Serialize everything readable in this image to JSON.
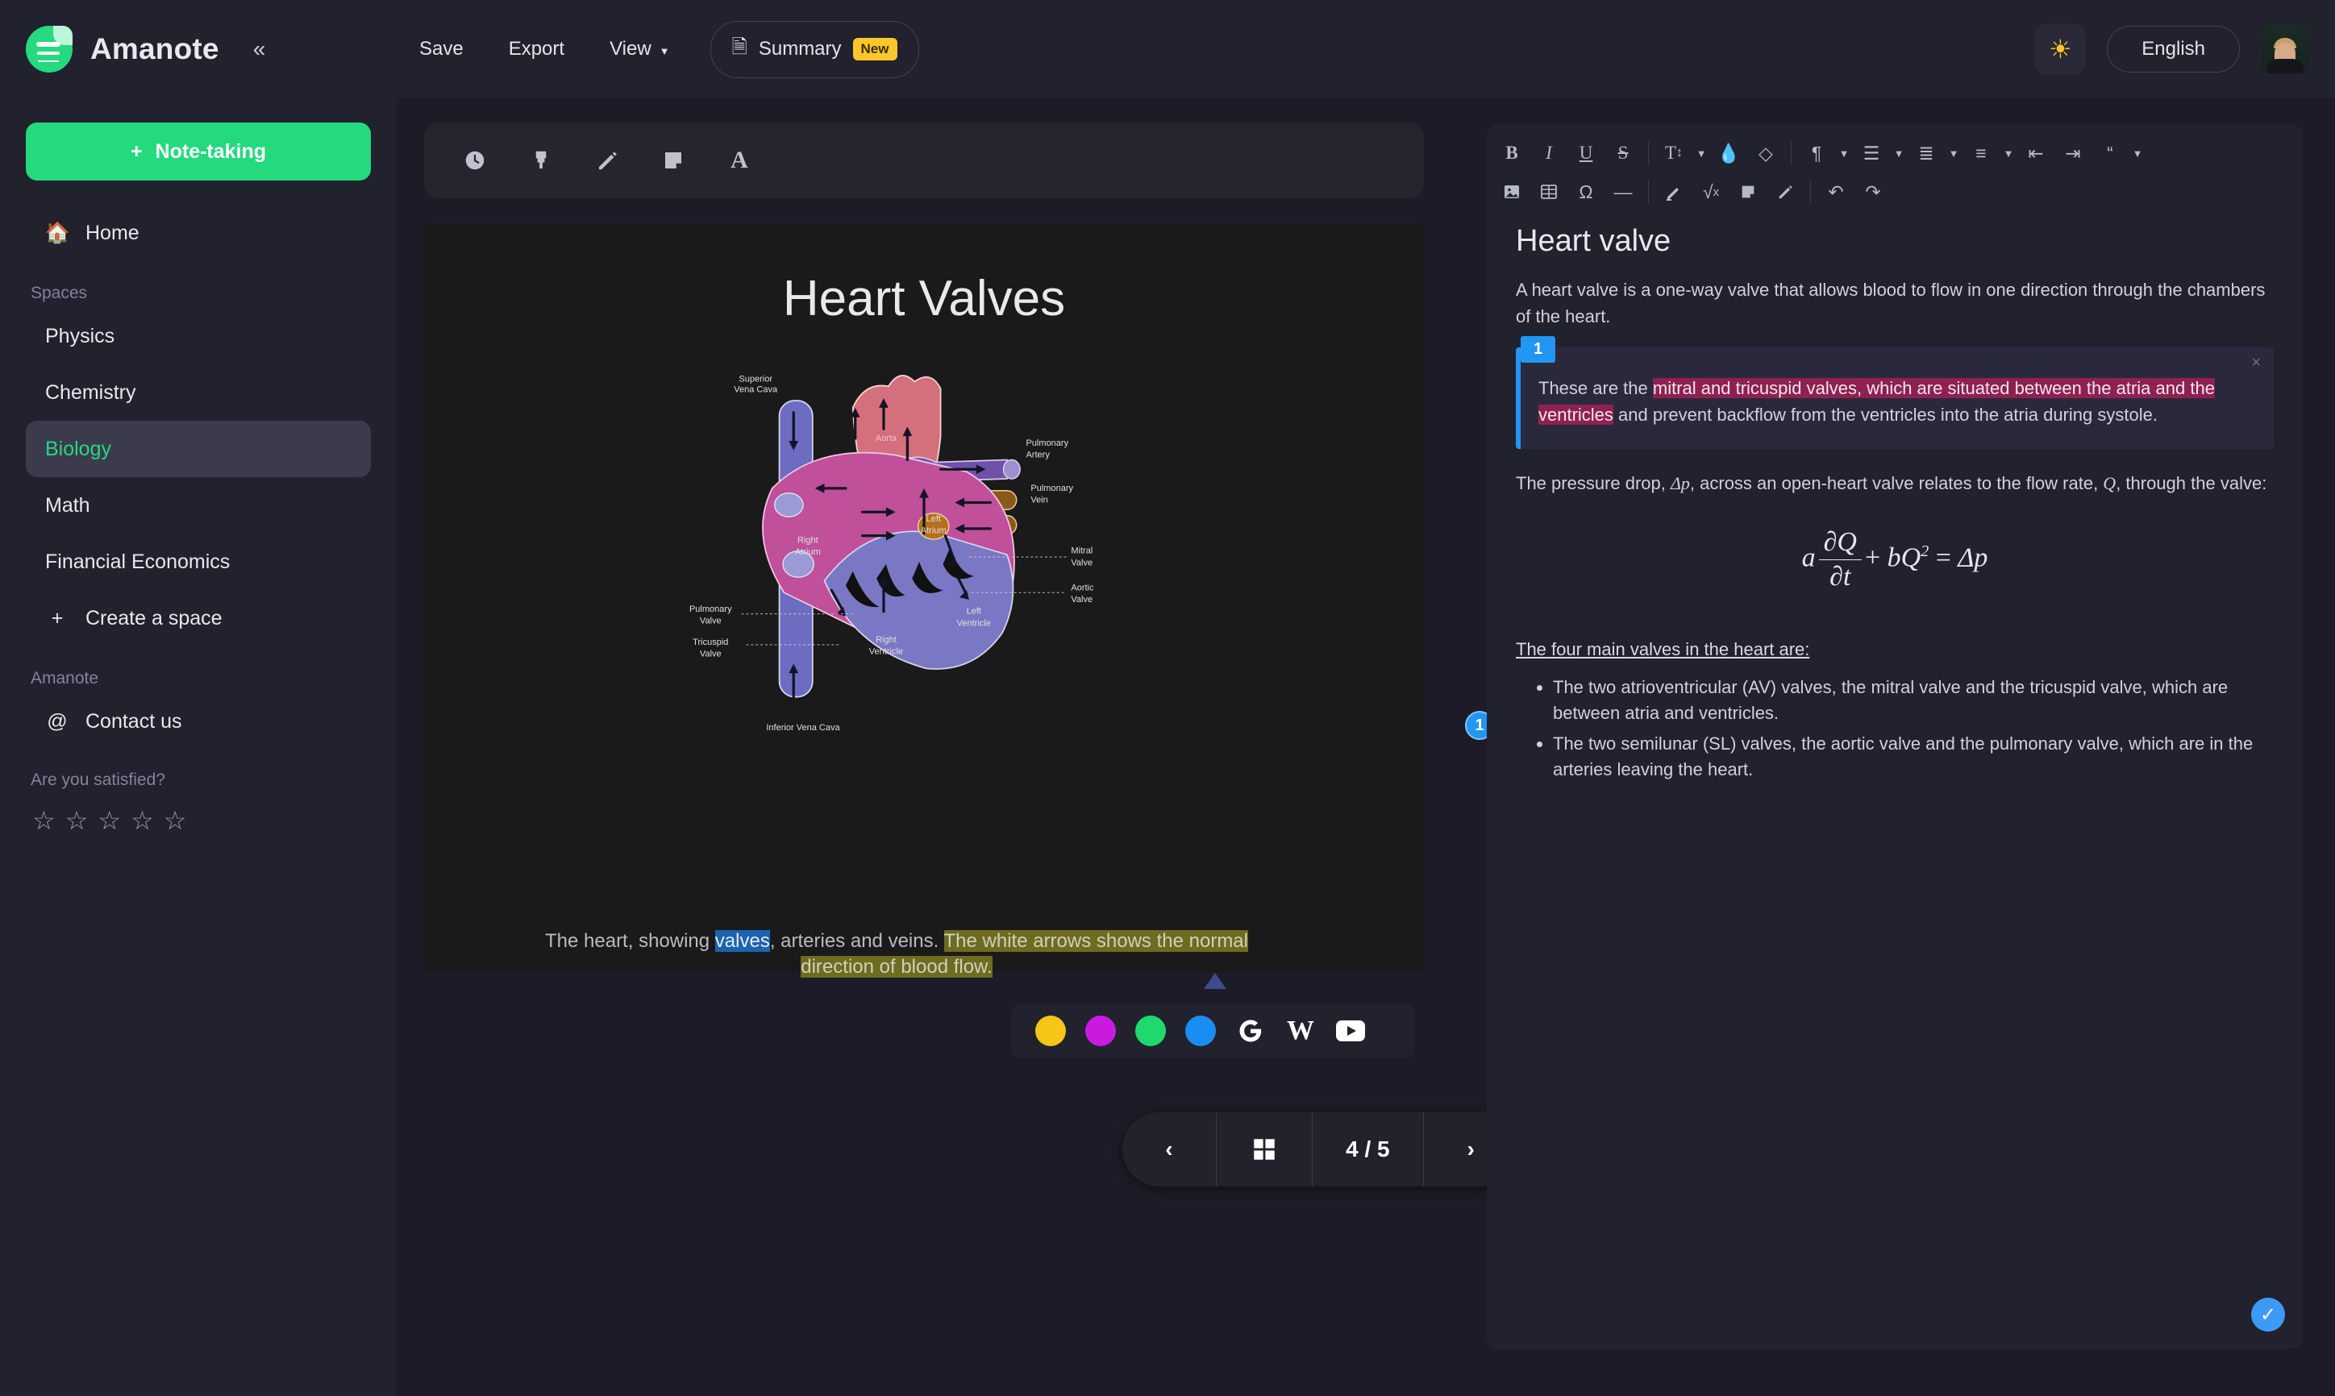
{
  "app": {
    "brand": "Amanote",
    "logo_color": "#24d97e",
    "collapse_icon": "chevron-double-left-icon"
  },
  "topbar": {
    "menu": [
      {
        "label": "Save",
        "name": "save"
      },
      {
        "label": "Export",
        "name": "export"
      },
      {
        "label": "View",
        "name": "view",
        "has_caret": true
      }
    ],
    "summary": {
      "label": "Summary",
      "badge": "New",
      "badge_color": "#fcc72c",
      "icon": "document-icon"
    },
    "theme_icon": "sun-icon",
    "language": "English",
    "avatar_name": "user-avatar"
  },
  "sidebar": {
    "note_taking_label": "Note-taking",
    "home_label": "Home",
    "spaces_heading": "Spaces",
    "spaces": [
      {
        "label": "Physics",
        "active": false
      },
      {
        "label": "Chemistry",
        "active": false
      },
      {
        "label": "Biology",
        "active": true
      },
      {
        "label": "Math",
        "active": false
      },
      {
        "label": "Financial Economics",
        "active": false
      }
    ],
    "create_space_label": "Create a space",
    "amanote_heading": "Amanote",
    "contact_label": "Contact us",
    "satisfaction_label": "Are you satisfied?",
    "stars": [
      "☆",
      "☆",
      "☆",
      "☆",
      "☆"
    ],
    "active_color": "#24d97e"
  },
  "viewer": {
    "tools": [
      {
        "name": "history-clock-icon"
      },
      {
        "name": "highlighter-brush-icon"
      },
      {
        "name": "pencil-icon"
      },
      {
        "name": "sticky-note-icon"
      },
      {
        "name": "text-tool-icon"
      }
    ],
    "slide_title": "Heart Valves",
    "diagram": {
      "alt": "heart-anatomy-diagram",
      "labels": [
        "Superior Vena Cava",
        "Aorta",
        "Pulmonary Artery",
        "Pulmonary Vein",
        "Right Atrium",
        "Left Atrium",
        "Mitral Valve",
        "Aortic Valve",
        "Pulmonary Valve",
        "Tricuspid Valve",
        "Right Ventricle",
        "Left Ventricle",
        "Inferior Vena Cava"
      ]
    },
    "annotation_badge": "1",
    "caption": {
      "part1": "The heart, showing ",
      "highlight_blue": "valves",
      "part2": ", arteries and veins. ",
      "highlight_olive": "The white arrows shows the normal direction of blood flow."
    },
    "color_popup": {
      "swatches": [
        {
          "name": "yellow-swatch",
          "color": "#f5c518"
        },
        {
          "name": "magenta-swatch",
          "color": "#cb1ae0"
        },
        {
          "name": "green-swatch",
          "color": "#1fd96e"
        },
        {
          "name": "blue-swatch",
          "color": "#1a8ef0"
        }
      ],
      "sources": [
        {
          "name": "google-icon",
          "glyph": "G"
        },
        {
          "name": "wikipedia-icon",
          "glyph": "W"
        },
        {
          "name": "youtube-icon",
          "glyph": "▶"
        }
      ]
    },
    "pager": {
      "prev": "‹",
      "grid_icon": "grid-view-icon",
      "page_label": "4 / 5",
      "next": "›"
    }
  },
  "editor": {
    "toolbar_row1": [
      {
        "name": "bold-icon",
        "glyph": "B",
        "style": "bold"
      },
      {
        "name": "italic-icon",
        "glyph": "I",
        "style": "italic"
      },
      {
        "name": "underline-icon",
        "glyph": "U",
        "style": "underline"
      },
      {
        "name": "strikethrough-icon",
        "glyph": "S",
        "style": "strike"
      },
      {
        "name": "separator"
      },
      {
        "name": "font-size-icon",
        "glyph": "T↕",
        "caret": true
      },
      {
        "name": "text-color-icon",
        "glyph": "◆"
      },
      {
        "name": "clear-format-icon",
        "glyph": "◇"
      },
      {
        "name": "separator"
      },
      {
        "name": "paragraph-icon",
        "glyph": "¶",
        "caret": true
      },
      {
        "name": "align-icon",
        "glyph": "≡",
        "caret": true
      },
      {
        "name": "numbered-list-icon",
        "glyph": "≣",
        "caret": true
      },
      {
        "name": "bullet-list-icon",
        "glyph": "•≡",
        "caret": true
      },
      {
        "name": "outdent-icon",
        "glyph": "⇤"
      },
      {
        "name": "indent-icon",
        "glyph": "⇥"
      },
      {
        "name": "blockquote-icon",
        "glyph": "“",
        "caret": true
      }
    ],
    "toolbar_row2": [
      {
        "name": "insert-image-icon",
        "glyph": "Ὓc"
      },
      {
        "name": "insert-table-icon",
        "glyph": "⊞"
      },
      {
        "name": "special-character-icon",
        "glyph": "Ω"
      },
      {
        "name": "horizontal-rule-icon",
        "glyph": "—"
      },
      {
        "name": "separator"
      },
      {
        "name": "highlighter-icon",
        "glyph": "✒"
      },
      {
        "name": "math-formula-icon",
        "glyph": "√"
      },
      {
        "name": "sticky-note-icon",
        "glyph": "◱"
      },
      {
        "name": "draw-pencil-icon",
        "glyph": "✎"
      },
      {
        "name": "separator"
      },
      {
        "name": "undo-icon",
        "glyph": "↶"
      },
      {
        "name": "redo-icon",
        "glyph": "↷"
      }
    ],
    "doc_title": "Heart valve",
    "intro_paragraph": "A heart valve is a one-way valve that allows blood to flow in one direction through the chambers of the heart.",
    "annotation": {
      "number": "1",
      "close_glyph": "×",
      "text_before": "These are the ",
      "highlighted": "mitral and tricuspid valves, which are situated between the atria and the ventricles",
      "text_after": " and prevent backflow from the ventricles into the atria during systole.",
      "highlight_color": "#8e2150",
      "accent_color": "#2196f3"
    },
    "pressure_paragraph_1": "The pressure drop, ",
    "pressure_symbol_1": "Δp",
    "pressure_paragraph_2": ", across an open-heart valve relates to the flow rate, ",
    "pressure_symbol_2": "Q",
    "pressure_paragraph_3": ", through the valve:",
    "formula": {
      "lead": "a",
      "frac_num": "∂Q",
      "frac_den": "∂t",
      "plus": "+",
      "term2": "bQ",
      "term2_sup": "2",
      "equals": "=",
      "rhs": "Δp"
    },
    "list_heading": "The four main valves in the heart are:",
    "bullets": [
      "The two atrioventricular (AV) valves, the mitral valve and the tricuspid valve, which are between atria and ventricles.",
      "The two semilunar (SL) valves, the aortic valve and the pulmonary valve, which are in the arteries leaving the heart."
    ],
    "confirm_glyph": "✓",
    "confirm_color": "#3d9bf7"
  }
}
